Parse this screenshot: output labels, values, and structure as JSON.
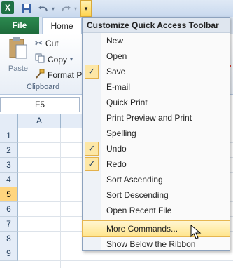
{
  "qat": {
    "logo": "X",
    "dropdown_glyph": "▾"
  },
  "tabs": {
    "file": "File",
    "home": "Home"
  },
  "ribbon": {
    "paste": "Paste",
    "cut": "Cut",
    "copy": "Copy",
    "format_painter": "Format Pa",
    "group_label": "Clipboard",
    "right_glyph": "A"
  },
  "formula_bar": {
    "name_box": "F5"
  },
  "grid": {
    "columns": [
      "A"
    ],
    "rows": [
      "1",
      "2",
      "3",
      "4",
      "5",
      "6",
      "7",
      "8",
      "9"
    ],
    "selected_row": "5"
  },
  "menu": {
    "title": "Customize Quick Access Toolbar",
    "items": [
      {
        "label": "New",
        "checked": false
      },
      {
        "label": "Open",
        "checked": false
      },
      {
        "label": "Save",
        "checked": true
      },
      {
        "label": "E-mail",
        "checked": false
      },
      {
        "label": "Quick Print",
        "checked": false
      },
      {
        "label": "Print Preview and Print",
        "checked": false
      },
      {
        "label": "Spelling",
        "checked": false
      },
      {
        "label": "Undo",
        "checked": true
      },
      {
        "label": "Redo",
        "checked": true
      },
      {
        "label": "Sort Ascending",
        "checked": false
      },
      {
        "label": "Sort Descending",
        "checked": false
      },
      {
        "label": "Open Recent File",
        "checked": false
      }
    ],
    "more_commands": "More Commands...",
    "show_below": "Show Below the Ribbon",
    "check_glyph": "✓"
  },
  "colors": {
    "file_tab": "#1e6b3b",
    "highlight": "#ffe58c",
    "row_selected": "#ffd57e"
  }
}
